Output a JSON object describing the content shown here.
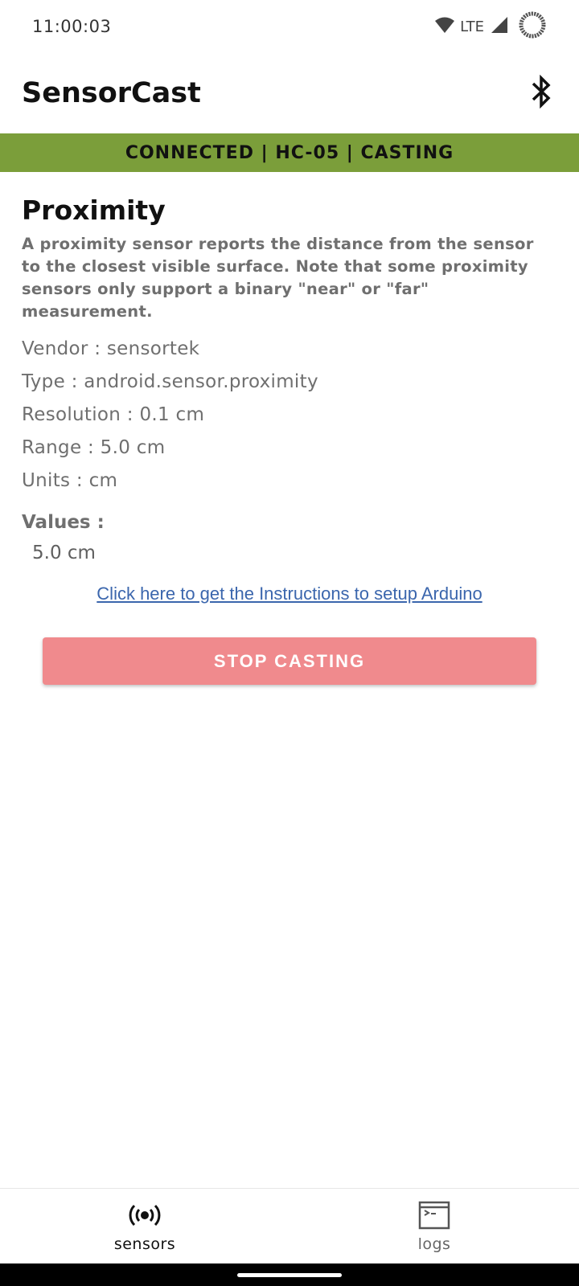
{
  "status_bar": {
    "time": "11:00:03",
    "network": "LTE",
    "icons": [
      "wifi-icon",
      "signal-icon",
      "battery-ring-icon"
    ]
  },
  "app_bar": {
    "title": "SensorCast",
    "action_icon": "bluetooth-icon"
  },
  "banner": {
    "text": "CONNECTED | HC-05 | CASTING",
    "color": "#7b9e3a"
  },
  "sensor": {
    "name": "Proximity",
    "description": "A proximity sensor reports the distance from the sensor to the closest visible surface. Note that some proximity sensors only support a binary \"near\" or \"far\" measurement.",
    "properties": [
      "Vendor : sensortek",
      "Type : android.sensor.proximity",
      "Resolution : 0.1 cm",
      "Range : 5.0 cm",
      "Units : cm"
    ],
    "values_label": "Values :",
    "value": "5.0 cm"
  },
  "instructions_link": "Click here to get the Instructions to setup Arduino",
  "stop_button": {
    "label": "STOP CASTING",
    "color": "#f08a8d"
  },
  "bottom_nav": {
    "items": [
      {
        "label": "sensors",
        "icon": "broadcast-icon",
        "active": true
      },
      {
        "label": "logs",
        "icon": "terminal-icon",
        "active": false
      }
    ]
  }
}
